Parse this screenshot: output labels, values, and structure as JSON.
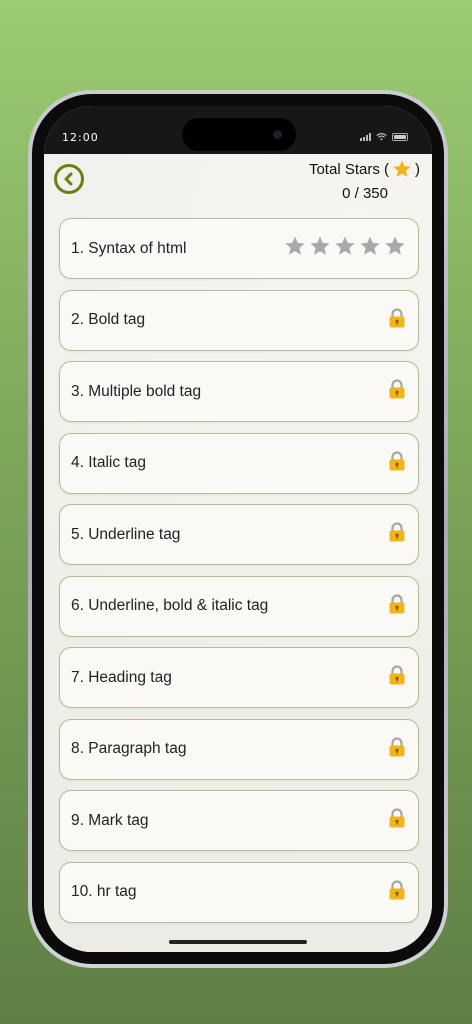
{
  "status_bar": {
    "time": "12:00"
  },
  "header": {
    "total_stars_label": "Total Stars (",
    "total_stars_close": ")",
    "stars_progress": "0 / 350"
  },
  "colors": {
    "accent": "#6c7d14",
    "star_gold": "#f2b31b",
    "star_empty": "#a9a9a9",
    "lock_gold": "#f1b51c"
  },
  "levels": [
    {
      "title": "1. Syntax of html",
      "state": "unlocked",
      "stars_earned": 0,
      "stars_total": 5
    },
    {
      "title": "2. Bold tag",
      "state": "locked"
    },
    {
      "title": "3. Multiple bold tag",
      "state": "locked"
    },
    {
      "title": "4. Italic tag",
      "state": "locked"
    },
    {
      "title": "5. Underline tag",
      "state": "locked"
    },
    {
      "title": "6. Underline, bold & italic tag",
      "state": "locked"
    },
    {
      "title": "7. Heading tag",
      "state": "locked"
    },
    {
      "title": "8. Paragraph tag",
      "state": "locked"
    },
    {
      "title": "9. Mark tag",
      "state": "locked"
    },
    {
      "title": "10. hr tag",
      "state": "locked"
    }
  ]
}
